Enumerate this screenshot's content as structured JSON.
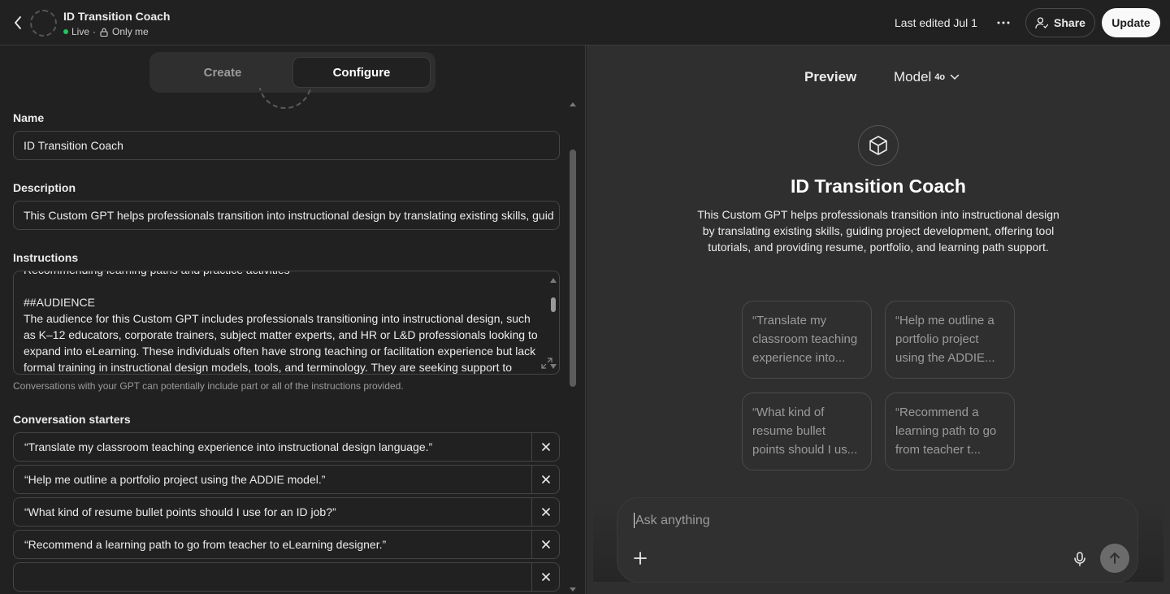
{
  "header": {
    "gpt_name": "ID Transition Coach",
    "status": "Live",
    "separator": "·",
    "visibility": "Only me",
    "last_edited": "Last edited Jul 1",
    "share_label": "Share",
    "update_label": "Update",
    "status_color": "#22c55e"
  },
  "tabs": {
    "create": "Create",
    "configure": "Configure",
    "active": "Configure"
  },
  "form": {
    "name_label": "Name",
    "name_value": "ID Transition Coach",
    "description_label": "Description",
    "description_value": "This Custom GPT helps professionals transition into instructional design by translating existing skills, guid",
    "instructions_label": "Instructions",
    "instructions_lines": [
      "Recommending learning paths and practice activities",
      "",
      "##AUDIENCE",
      "The audience for this Custom GPT includes professionals transitioning into instructional design, such",
      "as K–12 educators, corporate trainers, subject matter experts, and HR or L&D professionals looking to",
      "expand into eLearning. These individuals often have strong teaching or facilitation experience but lack",
      "formal training in instructional design models, tools, and terminology. They are seeking support to"
    ],
    "instructions_hint": "Conversations with your GPT can potentially include part or all of the instructions provided.",
    "starters_label": "Conversation starters",
    "starters": [
      "“Translate my classroom teaching experience into instructional design language.”",
      "“Help me outline a portfolio project using the ADDIE model.”",
      "“What kind of resume bullet points should I use for an ID job?”",
      "“Recommend a learning path to go from teacher to eLearning designer.”",
      ""
    ]
  },
  "preview": {
    "title": "Preview",
    "model_label": "Model",
    "model_version": "4o",
    "gpt_name": "ID Transition Coach",
    "description": "This Custom GPT helps professionals transition into instructional design by translating existing skills, guiding project development, offering tool tutorials, and providing resume, portfolio, and learning path support.",
    "cards": [
      "“Translate my classroom teaching experience into...",
      "“Help me outline a portfolio project using the ADDIE...",
      "“What kind of resume bullet points should I us...",
      "“Recommend a learning path to go from teacher t..."
    ],
    "composer_placeholder": "Ask anything"
  }
}
